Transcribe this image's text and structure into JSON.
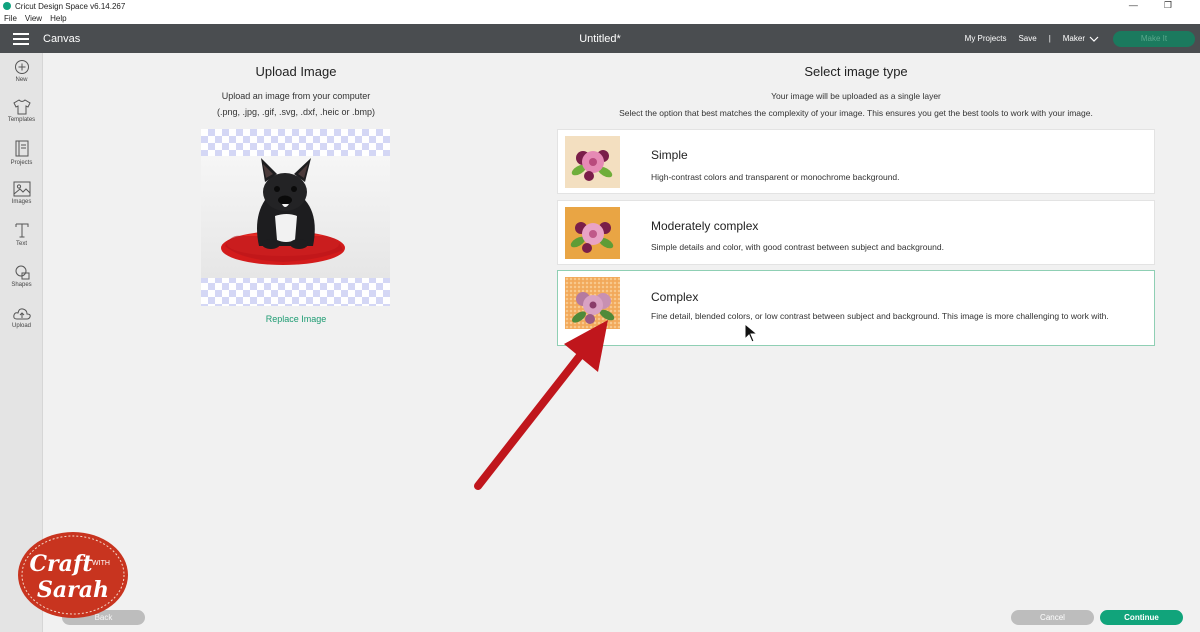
{
  "titlebar": {
    "app_title": "Cricut Design Space  v6.14.267",
    "minimize": "—",
    "restore": "❐"
  },
  "menubar": {
    "items": [
      "File",
      "View",
      "Help"
    ]
  },
  "header": {
    "canvas_label": "Canvas",
    "doc_title": "Untitled*",
    "my_projects": "My Projects",
    "save": "Save",
    "separator": "|",
    "machine": "Maker",
    "make_it": "Make It"
  },
  "sidebar": {
    "items": [
      {
        "label": "New",
        "icon": "plus-icon"
      },
      {
        "label": "Templates",
        "icon": "shirt-icon"
      },
      {
        "label": "Projects",
        "icon": "book-icon"
      },
      {
        "label": "Images",
        "icon": "image-icon"
      },
      {
        "label": "Text",
        "icon": "text-icon"
      },
      {
        "label": "Shapes",
        "icon": "shapes-icon"
      },
      {
        "label": "Upload",
        "icon": "cloud-upload-icon"
      }
    ]
  },
  "upload": {
    "title": "Upload Image",
    "line1": "Upload an image from your computer",
    "line2": "(.png, .jpg, .gif, .svg, .dxf, .heic or .bmp)",
    "replace": "Replace Image"
  },
  "select": {
    "title": "Select image type",
    "line1": "Your image will be uploaded as a single layer",
    "line2": "Select the option that best matches the complexity of your image. This ensures you get the best tools to work with your image.",
    "options": [
      {
        "title": "Simple",
        "desc": "High-contrast colors and transparent or monochrome background.",
        "thumb_bg": "#f3dfc0"
      },
      {
        "title": "Moderately complex",
        "desc": "Simple details and color, with good contrast between subject and background.",
        "thumb_bg": "#e9a544"
      },
      {
        "title": "Complex",
        "desc": "Fine detail, blended colors, or low contrast between subject and background. This image is more challenging to work with.",
        "thumb_bg": "#f2a95a",
        "selected": true
      }
    ]
  },
  "footer": {
    "back": "Back",
    "cancel": "Cancel",
    "continue": "Continue"
  },
  "logo": {
    "line1": "Craft",
    "with": "WITH",
    "line2": "Sarah"
  },
  "colors": {
    "accent": "#11a47b",
    "header": "#4a4d50",
    "arrow": "#c0161c"
  }
}
